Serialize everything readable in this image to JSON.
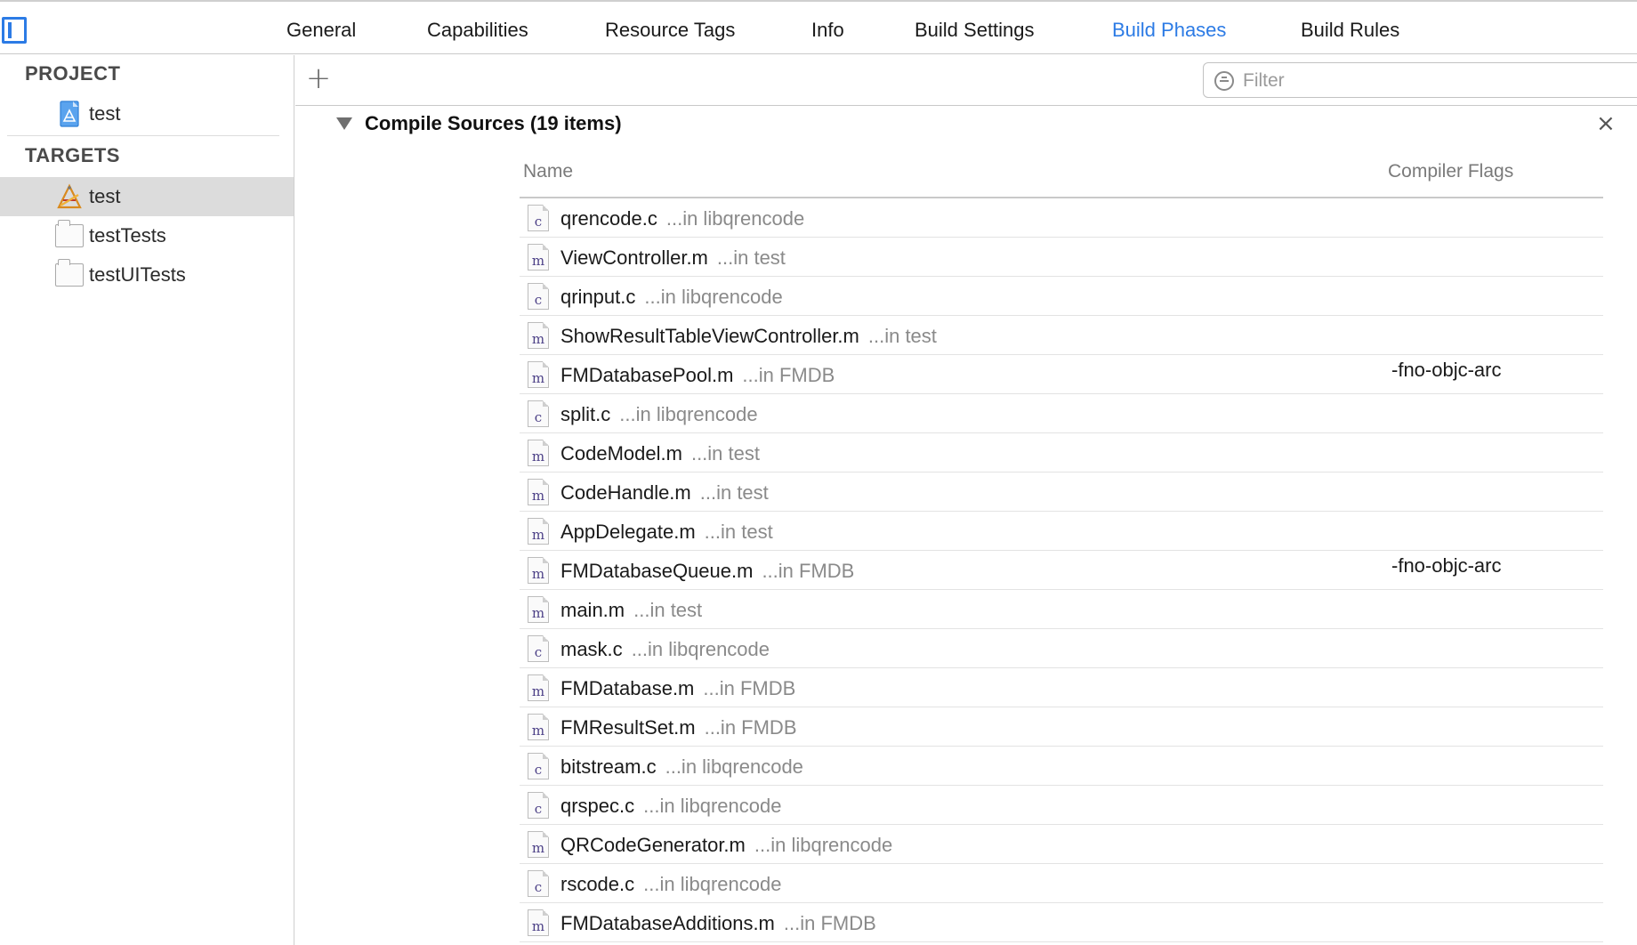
{
  "tabs": [
    {
      "label": "General"
    },
    {
      "label": "Capabilities"
    },
    {
      "label": "Resource Tags"
    },
    {
      "label": "Info"
    },
    {
      "label": "Build Settings"
    },
    {
      "label": "Build Phases",
      "active": true
    },
    {
      "label": "Build Rules"
    }
  ],
  "accent_color": "#2c7be5",
  "navigator": {
    "project_heading": "PROJECT",
    "project_name": "test",
    "targets_heading": "TARGETS",
    "targets": [
      {
        "label": "test",
        "selected": true,
        "icon": "app-target-icon"
      },
      {
        "label": "testTests",
        "icon": "folder-icon"
      },
      {
        "label": "testUITests",
        "icon": "folder-icon"
      }
    ]
  },
  "toolbar": {
    "add_label": "+",
    "filter_placeholder": "Filter"
  },
  "phase": {
    "title": "Compile Sources (19 items)",
    "close_label": "×",
    "column_name": "Name",
    "column_flags": "Compiler Flags",
    "files": [
      {
        "name": "qrencode.c",
        "location": "...in libqrencode",
        "type": "c",
        "flags": ""
      },
      {
        "name": "ViewController.m",
        "location": "...in test",
        "type": "m",
        "flags": ""
      },
      {
        "name": "qrinput.c",
        "location": "...in libqrencode",
        "type": "c",
        "flags": ""
      },
      {
        "name": "ShowResultTableViewController.m",
        "location": "...in test",
        "type": "m",
        "flags": ""
      },
      {
        "name": "FMDatabasePool.m",
        "location": "...in FMDB",
        "type": "m",
        "flags": "-fno-objc-arc"
      },
      {
        "name": "split.c",
        "location": "...in libqrencode",
        "type": "c",
        "flags": ""
      },
      {
        "name": "CodeModel.m",
        "location": "...in test",
        "type": "m",
        "flags": ""
      },
      {
        "name": "CodeHandle.m",
        "location": "...in test",
        "type": "m",
        "flags": ""
      },
      {
        "name": "AppDelegate.m",
        "location": "...in test",
        "type": "m",
        "flags": ""
      },
      {
        "name": "FMDatabaseQueue.m",
        "location": "...in FMDB",
        "type": "m",
        "flags": "-fno-objc-arc"
      },
      {
        "name": "main.m",
        "location": "...in test",
        "type": "m",
        "flags": ""
      },
      {
        "name": "mask.c",
        "location": "...in libqrencode",
        "type": "c",
        "flags": ""
      },
      {
        "name": "FMDatabase.m",
        "location": "...in FMDB",
        "type": "m",
        "flags": ""
      },
      {
        "name": "FMResultSet.m",
        "location": "...in FMDB",
        "type": "m",
        "flags": ""
      },
      {
        "name": "bitstream.c",
        "location": "...in libqrencode",
        "type": "c",
        "flags": ""
      },
      {
        "name": "qrspec.c",
        "location": "...in libqrencode",
        "type": "c",
        "flags": ""
      },
      {
        "name": "QRCodeGenerator.m",
        "location": "...in libqrencode",
        "type": "m",
        "flags": ""
      },
      {
        "name": "rscode.c",
        "location": "...in libqrencode",
        "type": "c",
        "flags": ""
      },
      {
        "name": "FMDatabaseAdditions.m",
        "location": "...in FMDB",
        "type": "m",
        "flags": ""
      }
    ]
  }
}
